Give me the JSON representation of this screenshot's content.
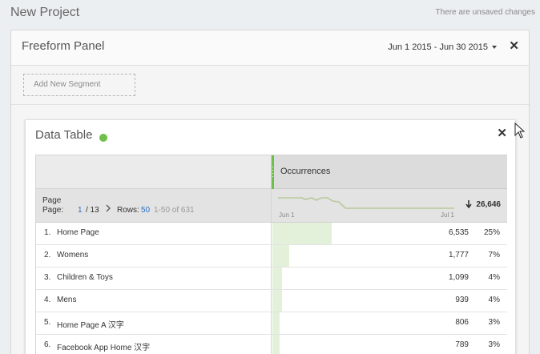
{
  "project": {
    "title": "New Project",
    "unsaved": "There are unsaved changes"
  },
  "panel": {
    "title": "Freeform Panel",
    "date_range": "Jun 1 2015 - Jun 30 2015",
    "close": "✕",
    "add_segment": "Add New Segment"
  },
  "viz": {
    "title": "Data Table",
    "status_color": "#6fbf4b",
    "close": "✕"
  },
  "table": {
    "metric_header": "Occurrences",
    "dimension_label": "Page",
    "page_label": "Page:",
    "page_current": "1",
    "page_total": "/ 13",
    "next_icon": "chevron-right-icon",
    "rows_label": "Rows:",
    "rows_value": "50",
    "range_info": "1-50 of 631",
    "trend_start": "Jun 1",
    "trend_end": "Jul 1",
    "total": "26,646",
    "rows": [
      {
        "num": "1.",
        "name": "Home Page",
        "value": "6,535",
        "pct": "25%",
        "share": 0.25
      },
      {
        "num": "2.",
        "name": "Womens",
        "value": "1,777",
        "pct": "7%",
        "share": 0.07
      },
      {
        "num": "3.",
        "name": "Children & Toys",
        "value": "1,099",
        "pct": "4%",
        "share": 0.04
      },
      {
        "num": "4.",
        "name": "Mens",
        "value": "939",
        "pct": "4%",
        "share": 0.04
      },
      {
        "num": "5.",
        "name": "Home Page A 汉字",
        "value": "806",
        "pct": "3%",
        "share": 0.03
      },
      {
        "num": "6.",
        "name": "Facebook App Home 汉字",
        "value": "789",
        "pct": "3%",
        "share": 0.03
      }
    ]
  },
  "colors": {
    "accent_green": "#6fbf4b",
    "link_blue": "#2d6fc4",
    "bar_fill": "#e3f0da"
  }
}
